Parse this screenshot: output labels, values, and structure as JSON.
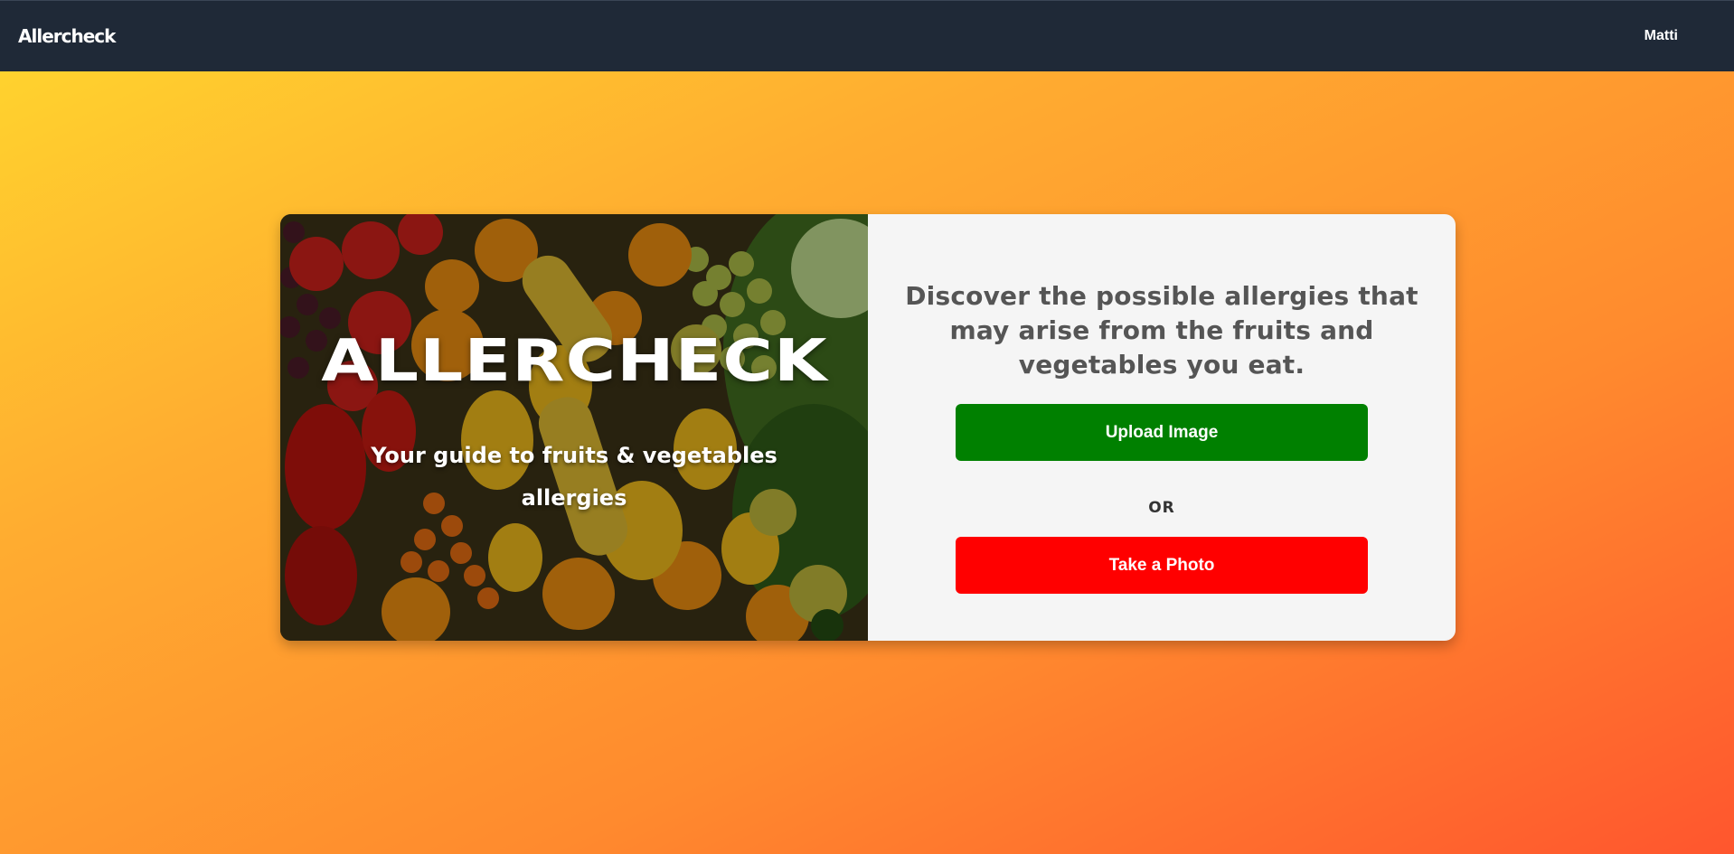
{
  "navbar": {
    "brand": "Allercheck",
    "user": "Matti"
  },
  "hero": {
    "title": "ALLERCHECK",
    "subtitle": "Your guide to fruits & vegetables allergies"
  },
  "panel": {
    "headline": "Discover the possible allergies that may arise from the fruits and vegetables you eat.",
    "upload_label": "Upload Image",
    "or_label": "OR",
    "photo_label": "Take a Photo"
  },
  "colors": {
    "navbar_bg": "#1f2937",
    "upload_button": "#008000",
    "photo_button": "#ff0000",
    "panel_bg": "#f5f5f5",
    "gradient": [
      "#ffd22e",
      "#ffac30",
      "#ff8a2e",
      "#ff562e"
    ]
  }
}
